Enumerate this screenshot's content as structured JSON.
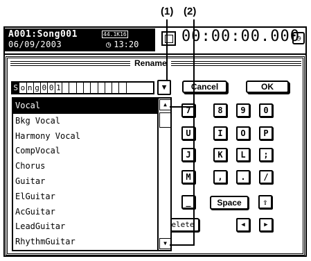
{
  "callouts": [
    "(1)",
    "(2)"
  ],
  "header": {
    "song_title": "A001:Song001",
    "date": "06/09/2003",
    "format_badge": "44.1K16",
    "clock_icon": "clock-icon",
    "time": "13:20",
    "timecode": "00:00:00.000"
  },
  "dialog": {
    "title": "Rename",
    "name_chars": [
      "S",
      "o",
      "n",
      "g",
      "0",
      "0",
      "1",
      "",
      "",
      "",
      "",
      "",
      "",
      "",
      "",
      "",
      ""
    ],
    "cancel_label": "Cancel",
    "ok_label": "OK",
    "list_items": [
      "Vocal",
      "Bkg Vocal",
      "Harmony Vocal",
      "CompVocal",
      "Chorus",
      "Guitar",
      "ElGuitar",
      "AcGuitar",
      "LeadGuitar",
      "RhythmGuitar"
    ],
    "selected_item": "Vocal",
    "keys_row1": [
      "7",
      "8",
      "9",
      "0"
    ],
    "keys_row2": [
      "U",
      "I",
      "O",
      "P"
    ],
    "keys_row3": [
      "J",
      "K",
      "L",
      ";"
    ],
    "keys_row4": [
      "M",
      ",",
      ".",
      "/"
    ],
    "key_dash": "_",
    "space_label": "Space",
    "delete_label": "elete",
    "left_arrow": "◀",
    "right_arrow": "▶"
  }
}
